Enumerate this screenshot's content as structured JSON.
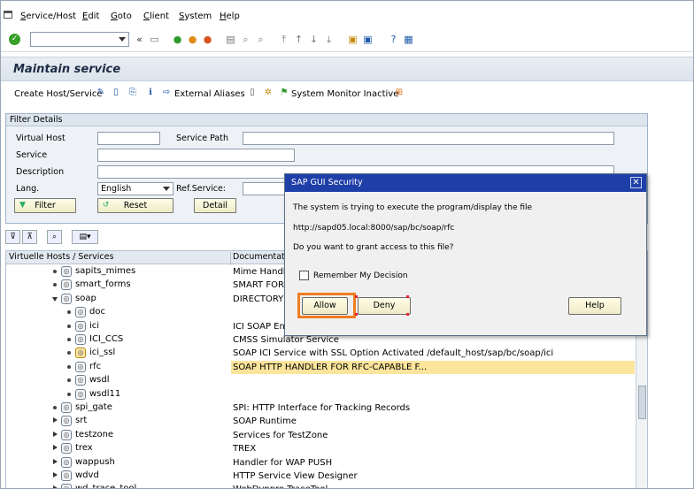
{
  "menu": {
    "items": [
      {
        "label": "Service/Host",
        "ul": "S",
        "rest": "ervice/Host"
      },
      {
        "label": "Edit",
        "ul": "E",
        "rest": "dit"
      },
      {
        "label": "Goto",
        "ul": "G",
        "rest": "oto"
      },
      {
        "label": "Client",
        "ul": "C",
        "rest": "lient"
      },
      {
        "label": "System",
        "ul": "S",
        "rest": "ystem"
      },
      {
        "label": "Help",
        "ul": "H",
        "rest": "elp"
      }
    ]
  },
  "toolbar": {
    "nav_back_symbol": "«"
  },
  "title": "Maintain service",
  "app_toolbar": {
    "create_host_service": "Create Host/Service",
    "external_aliases": "External Aliases",
    "system_monitor": "System Monitor Inactive"
  },
  "filter": {
    "header": "Filter Details",
    "virtual_host_label": "Virtual Host",
    "service_path_label": "Service Path",
    "service_label": "Service",
    "description_label": "Description",
    "lang_label": "Lang.",
    "lang_value": "English",
    "ref_service_label": "Ref.Service:",
    "filter_button": "Filter",
    "reset_button": "Reset",
    "detail_button": "Detail"
  },
  "tree": {
    "col_services": "Virtuelle Hosts / Services",
    "col_documentation": "Documentation",
    "rows": [
      {
        "name": "sapits_mimes",
        "desc": "Mime Handler",
        "kind": "bullet",
        "level": 1
      },
      {
        "name": "smart_forms",
        "desc": "SMART FORMS",
        "kind": "bullet",
        "level": 1
      },
      {
        "name": "soap",
        "desc": "DIRECTORY FO",
        "kind": "open",
        "level": 1
      },
      {
        "name": "doc",
        "desc": "",
        "kind": "bullet",
        "level": 2
      },
      {
        "name": "ici",
        "desc": "ICI SOAP Entr",
        "kind": "bullet",
        "level": 2
      },
      {
        "name": "ICI_CCS",
        "desc": "CMSS Simulator Service",
        "kind": "bullet",
        "level": 2
      },
      {
        "name": "ici_ssl",
        "desc": "SOAP ICI Service with SSL Option Activated  /default_host/sap/bc/soap/ici",
        "kind": "bullet",
        "level": 2,
        "warn": true
      },
      {
        "name": "rfc",
        "desc": "SOAP HTTP HANDLER FOR RFC-CAPABLE F...",
        "kind": "bullet",
        "level": 2,
        "selected": true
      },
      {
        "name": "wsdl",
        "desc": "",
        "kind": "bullet",
        "level": 2
      },
      {
        "name": "wsdl11",
        "desc": "",
        "kind": "bullet",
        "level": 2
      },
      {
        "name": "spi_gate",
        "desc": "SPI: HTTP Interface for Tracking Records",
        "kind": "bullet",
        "level": 1
      },
      {
        "name": "srt",
        "desc": "SOAP Runtime",
        "kind": "closed",
        "level": 1
      },
      {
        "name": "testzone",
        "desc": "Services for TestZone",
        "kind": "closed",
        "level": 1
      },
      {
        "name": "trex",
        "desc": "TREX",
        "kind": "closed",
        "level": 1
      },
      {
        "name": "wappush",
        "desc": "Handler for WAP PUSH",
        "kind": "closed",
        "level": 1
      },
      {
        "name": "wdvd",
        "desc": "HTTP Service View Designer",
        "kind": "closed",
        "level": 1
      },
      {
        "name": "wd_trace_tool",
        "desc": "WebDynpro TraceTool",
        "kind": "closed",
        "level": 1
      }
    ]
  },
  "dialog": {
    "title": "SAP GUI Security",
    "line1": "The system is trying to execute the program/display the file",
    "url": "http://sapd05.local:8000/sap/bc/soap/rfc",
    "question": "Do you want to grant access to this file?",
    "remember": "Remember My Decision",
    "allow": "Allow",
    "deny": "Deny",
    "help": "Help"
  },
  "colors": {
    "highlight_orange": "#ef7d22",
    "selected_row": "#fbe49b",
    "dialog_title_bg": "#1f3fa8"
  }
}
